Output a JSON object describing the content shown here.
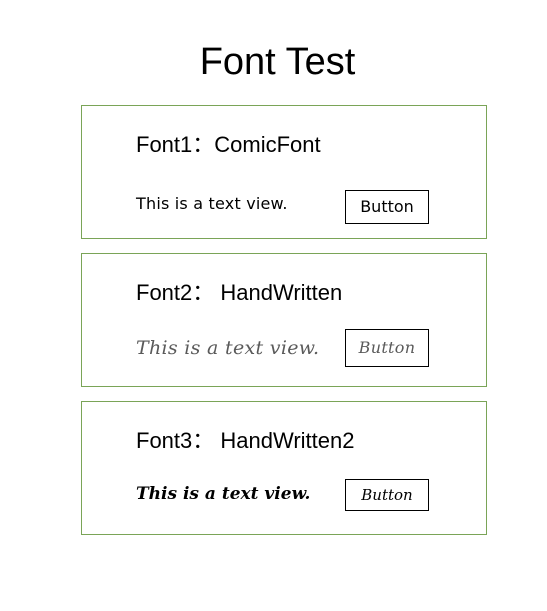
{
  "page": {
    "title": "Font Test"
  },
  "panels": [
    {
      "heading": "Font1：ComicFont",
      "text_view": "This is a text view.",
      "button_label": "Button"
    },
    {
      "heading": "Font2： HandWritten",
      "text_view": "This is a text view.",
      "button_label": "Button"
    },
    {
      "heading": "Font3： HandWritten2",
      "text_view": "This is a text view.",
      "button_label": "Button"
    }
  ],
  "colors": {
    "panel_border": "#7aa457",
    "handwritten_text": "#5a5a5a",
    "background": "#ffffff"
  }
}
